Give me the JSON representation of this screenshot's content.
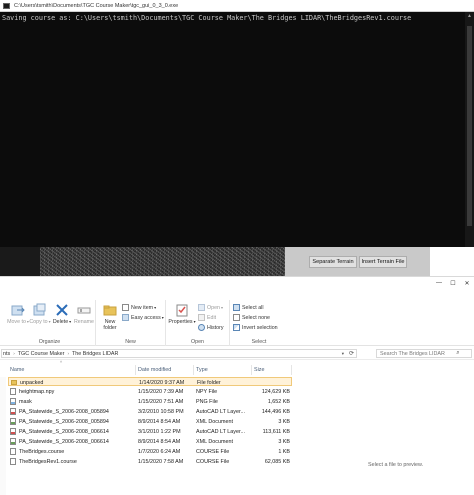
{
  "console": {
    "title": "C:\\Users\\tsmith\\Documents\\TGC Course Maker\\tgc_gui_0_3_0.exe",
    "output_line": "Saving course as: C:\\Users\\tsmith\\Documents\\TGC Course Maker\\The Bridges LIDAR\\TheBridgesRev1.course"
  },
  "gui": {
    "separate_terrain": "Separate Terrain",
    "insert_terrain_file": "Insert Terrain File"
  },
  "window": {
    "minimize": "—",
    "maximize": "☐",
    "close": "✕"
  },
  "ribbon": {
    "organize": {
      "label": "Organize",
      "move_to": "Move to",
      "copy_to": "Copy to",
      "delete": "Delete",
      "rename": "Rename"
    },
    "new": {
      "label": "New",
      "new_folder_line1": "New",
      "new_folder_line2": "folder",
      "new_item": "New item",
      "easy_access": "Easy access"
    },
    "open": {
      "label": "Open",
      "properties": "Properties",
      "open": "Open",
      "edit": "Edit",
      "history": "History"
    },
    "select": {
      "label": "Select",
      "select_all": "Select all",
      "select_none": "Select none",
      "invert_selection": "Invert selection"
    }
  },
  "address": {
    "crumb_prefix": "nts",
    "crumb_1": "TGC Course Maker",
    "crumb_2": "The Bridges LIDAR",
    "search_placeholder": "Search The Bridges LIDAR"
  },
  "columns": {
    "name": "Name",
    "date": "Date modified",
    "type": "Type",
    "size": "Size"
  },
  "files": [
    {
      "name": "unpacked",
      "date": "1/14/2020 9:37 AM",
      "type": "File folder",
      "size": "",
      "icon": "folder"
    },
    {
      "name": "heightmap.npy",
      "date": "1/15/2020 7:39 AM",
      "type": "NPY File",
      "size": "124,629 KB",
      "icon": "doc"
    },
    {
      "name": "mask",
      "date": "1/15/2020 7:51 AM",
      "type": "PNG File",
      "size": "1,652 KB",
      "icon": "img"
    },
    {
      "name": "PA_Statewide_S_2006-2008_005894",
      "date": "3/2/2010 10:58 PM",
      "type": "AutoCAD LT Layer...",
      "size": "144,496 KB",
      "icon": "cad"
    },
    {
      "name": "PA_Statewide_S_2006-2008_005894",
      "date": "8/9/2014 8:54 AM",
      "type": "XML Document",
      "size": "3 KB",
      "icon": "xml"
    },
    {
      "name": "PA_Statewide_S_2006-2008_006614",
      "date": "3/1/2010 1:22 PM",
      "type": "AutoCAD LT Layer...",
      "size": "113,611 KB",
      "icon": "cad"
    },
    {
      "name": "PA_Statewide_S_2006-2008_006614",
      "date": "8/9/2014 8:54 AM",
      "type": "XML Document",
      "size": "3 KB",
      "icon": "xml"
    },
    {
      "name": "TheBridges.course",
      "date": "1/7/2020 6:24 AM",
      "type": "COURSE File",
      "size": "1 KB",
      "icon": "doc"
    },
    {
      "name": "TheBridgesRev1.course",
      "date": "1/15/2020 7:58 AM",
      "type": "COURSE File",
      "size": "62,085 KB",
      "icon": "doc"
    }
  ],
  "preview": {
    "text": "Select a file to preview."
  }
}
